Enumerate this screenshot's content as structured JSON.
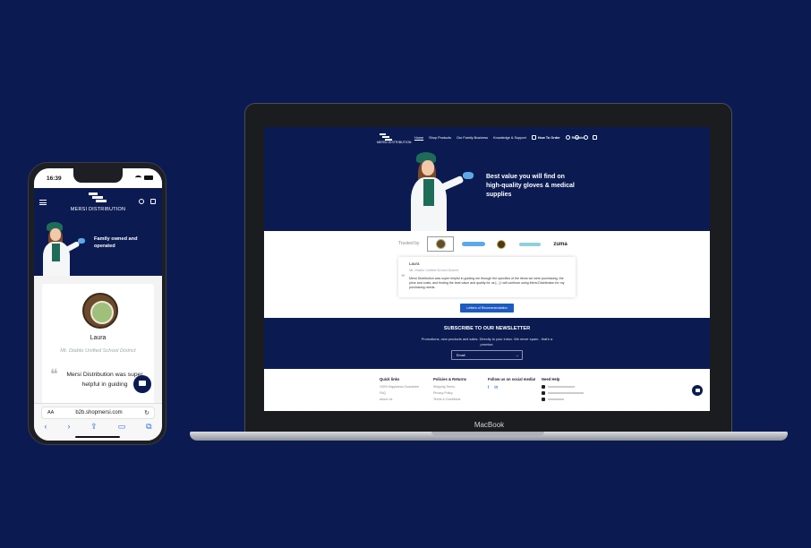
{
  "brand": {
    "name": "MERSI DISTRIBUTION"
  },
  "phone": {
    "time": "16:39",
    "hero_text": "Family owned and operated",
    "testimonial": {
      "name": "Laura",
      "school": "Mt. Diablo Unified School District",
      "quote": "Mersi Distribution was super helpful in guiding"
    },
    "browser": {
      "aa": "AA",
      "url": "b2b.shopmersi.com",
      "reload": "↻",
      "back": "‹",
      "forward": "›",
      "share": "⇪",
      "bookmarks": "▭",
      "tabs": "⧉"
    }
  },
  "laptop": {
    "nav": {
      "links": [
        "Home",
        "Shop Products",
        "Our Family Business",
        "Knowledge & Support",
        "How To Order",
        "Reorder"
      ],
      "active": "Home"
    },
    "hero_text": "Best value you will find on high-quality gloves & medical supplies",
    "trusted_label": "Trusted by",
    "brands": [
      "Mt. Diablo seal",
      "brand-2",
      "seal",
      "brand-4",
      "zuma"
    ],
    "zuma_label": "zuma",
    "testimonial": {
      "name": "Laura",
      "school": "Mt. Diablo Unified School District",
      "quote": "Mersi Distribution was super helpful in guiding me through the specifics of the items we were purchasing, the price and costs, and finding the best value and quality for us [...] I will continue using Mersi Distribution for my purchasing needs."
    },
    "letters_button": "Letters of Recommendation",
    "newsletter": {
      "title": "SUBSCRIBE TO OUR NEWSLETTER",
      "subtitle": "Promotions, new products and sales. Directly to your inbox. We never spam - that's a promise.",
      "email_placeholder": "Email",
      "submit": "→"
    },
    "footer": {
      "quick_links": {
        "title": "Quick links",
        "items": [
          "100% Happiness Guarantee",
          "FAQ",
          "About Us"
        ]
      },
      "policies": {
        "title": "Policies & Returns",
        "items": [
          "Shipping Terms",
          "Privacy Policy",
          "Terms & Conditions"
        ]
      },
      "social": {
        "title": "Follow us on social media!",
        "twitter": "t",
        "linkedin": "in"
      },
      "help": {
        "title": "Need Help"
      }
    },
    "macbook_label": "MacBook"
  },
  "colors": {
    "navy": "#0b1b52",
    "accent_blue": "#1d5bbf",
    "scrub_green": "#1f6b59",
    "glove_blue": "#5fa8e8"
  }
}
